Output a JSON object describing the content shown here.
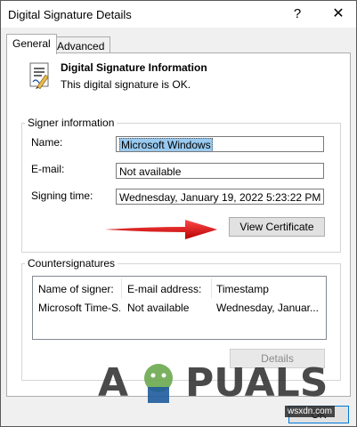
{
  "window": {
    "title": "Digital Signature Details",
    "help_glyph": "?",
    "close_glyph": "✕"
  },
  "tabs": [
    {
      "label": "General",
      "active": true
    },
    {
      "label": "Advanced",
      "active": false
    }
  ],
  "info": {
    "title": "Digital Signature Information",
    "status": "This digital signature is OK."
  },
  "signer": {
    "group_label": "Signer information",
    "name_label": "Name:",
    "name_value": "Microsoft Windows",
    "email_label": "E-mail:",
    "email_value": "Not available",
    "time_label": "Signing time:",
    "time_value": "Wednesday, January 19, 2022 5:23:22 PM",
    "view_button": "View Certificate"
  },
  "countersignatures": {
    "group_label": "Countersignatures",
    "columns": [
      "Name of signer:",
      "E-mail address:",
      "Timestamp"
    ],
    "rows": [
      [
        "Microsoft Time-S...",
        "Not available",
        "Wednesday, Januar..."
      ]
    ],
    "details_button": "Details"
  },
  "footer": {
    "ok_button": "OK"
  },
  "watermark": {
    "text": "APPUALS",
    "site": "wsxdn.com"
  },
  "colors": {
    "arrow": "#e02020",
    "selection": "#99c9ef",
    "ok_border": "#0078d7"
  }
}
